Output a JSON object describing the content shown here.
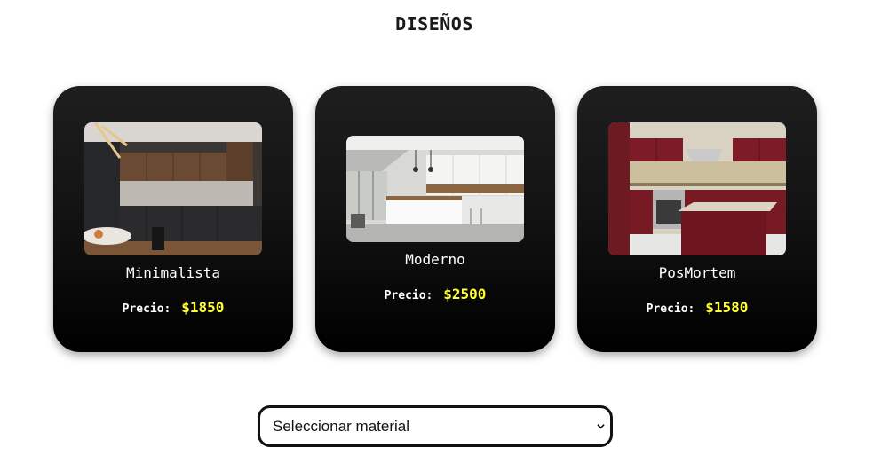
{
  "page": {
    "title": "DISEÑOS"
  },
  "designs": [
    {
      "name": "Minimalista",
      "price_label": "Precio:",
      "price": "$1850",
      "image": "minimalist-kitchen-photo"
    },
    {
      "name": "Moderno",
      "price_label": "Precio:",
      "price": "$2500",
      "image": "modern-kitchen-photo"
    },
    {
      "name": "PosMortem",
      "price_label": "Precio:",
      "price": "$1580",
      "image": "red-kitchen-photo"
    }
  ],
  "material_select": {
    "selected": "Seleccionar material",
    "icon": "chevron-down-icon"
  },
  "colors": {
    "card_top": "#1e1e1e",
    "card_bottom": "#000000",
    "price_accent": "#ffff33",
    "text_light": "#ffffff"
  }
}
